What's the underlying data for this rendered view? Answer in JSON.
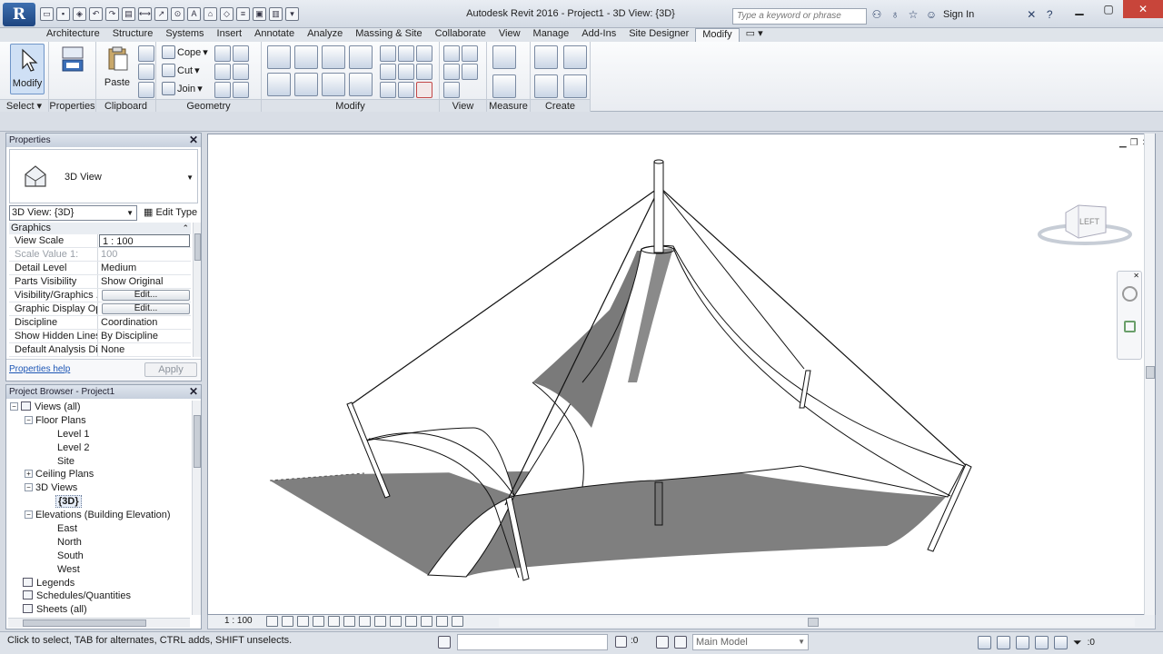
{
  "window": {
    "title": "Autodesk Revit 2016 -     Project1 - 3D View: {3D}",
    "search_placeholder": "Type a keyword or phrase",
    "signin": "Sign In",
    "app_logo": "R"
  },
  "tabs": [
    {
      "label": "Architecture"
    },
    {
      "label": "Structure"
    },
    {
      "label": "Systems"
    },
    {
      "label": "Insert"
    },
    {
      "label": "Annotate"
    },
    {
      "label": "Analyze"
    },
    {
      "label": "Massing & Site"
    },
    {
      "label": "Collaborate"
    },
    {
      "label": "View"
    },
    {
      "label": "Manage"
    },
    {
      "label": "Add-Ins"
    },
    {
      "label": "Site Designer"
    },
    {
      "label": "Modify",
      "active": true
    }
  ],
  "ribbon": {
    "modify_label": "Modify",
    "paste_label": "Paste",
    "cope_label": "Cope",
    "cut_label": "Cut",
    "join_label": "Join",
    "panels": {
      "select": "Select",
      "properties": "Properties",
      "clipboard": "Clipboard",
      "geometry": "Geometry",
      "modify": "Modify",
      "view": "View",
      "measure": "Measure",
      "create": "Create"
    }
  },
  "properties": {
    "header": "Properties",
    "type_name": "3D View",
    "instance_selector": "3D View: {3D}",
    "edit_type": "Edit Type",
    "group": "Graphics",
    "rows": [
      {
        "key": "View Scale",
        "value": "1 : 100"
      },
      {
        "key": "Scale Value    1:",
        "value": "100"
      },
      {
        "key": "Detail Level",
        "value": "Medium"
      },
      {
        "key": "Parts Visibility",
        "value": "Show Original"
      },
      {
        "key": "Visibility/Graphics ...",
        "value": "Edit..."
      },
      {
        "key": "Graphic Display Op...",
        "value": "Edit..."
      },
      {
        "key": "Discipline",
        "value": "Coordination"
      },
      {
        "key": "Show Hidden Lines",
        "value": "By Discipline"
      },
      {
        "key": "Default Analysis Di...",
        "value": "None"
      }
    ],
    "help_link": "Properties help",
    "apply": "Apply"
  },
  "browser": {
    "header": "Project Browser - Project1",
    "nodes": [
      {
        "label": "Views (all)"
      },
      {
        "label": "Floor Plans"
      },
      {
        "label": "Level 1"
      },
      {
        "label": "Level 2"
      },
      {
        "label": "Site"
      },
      {
        "label": "Ceiling Plans"
      },
      {
        "label": "3D Views"
      },
      {
        "label": "{3D}"
      },
      {
        "label": "Elevations (Building Elevation)"
      },
      {
        "label": "East"
      },
      {
        "label": "North"
      },
      {
        "label": "South"
      },
      {
        "label": "West"
      },
      {
        "label": "Legends"
      },
      {
        "label": "Schedules/Quantities"
      },
      {
        "label": "Sheets (all)"
      }
    ]
  },
  "view": {
    "scale": "1 : 100",
    "viewcube_face": "LEFT"
  },
  "status": {
    "message": "Click to select, TAB for alternates, CTRL adds, SHIFT unselects.",
    "count1": ":0",
    "design_option": "Main Model",
    "filter_count": ":0"
  }
}
